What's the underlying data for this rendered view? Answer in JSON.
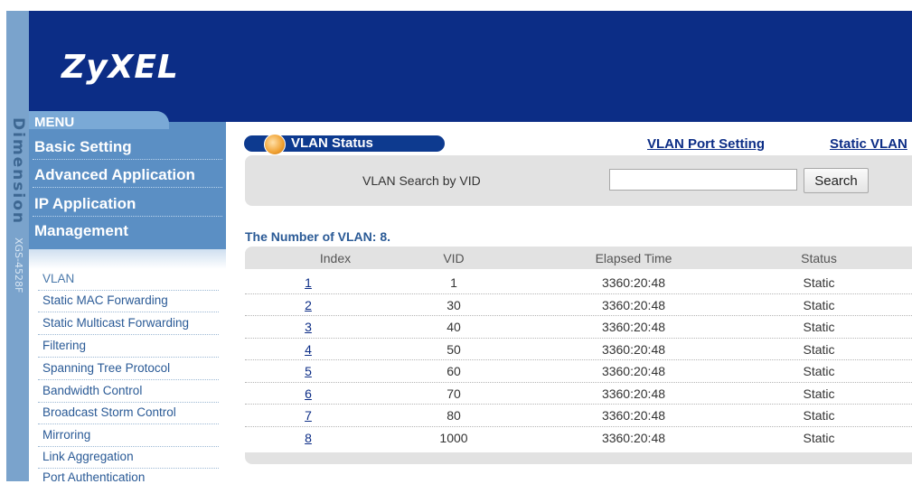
{
  "sidebar_brand": {
    "product": "Dimension",
    "model": "XGS-4528F"
  },
  "logo": "ZyXEL",
  "menu": {
    "title": "MENU",
    "sections": [
      {
        "label": "Basic Setting"
      },
      {
        "label": "Advanced Application"
      },
      {
        "label": "IP Application"
      },
      {
        "label": "Management"
      }
    ],
    "sub_items": [
      {
        "label": "VLAN"
      },
      {
        "label": "Static MAC Forwarding"
      },
      {
        "label": "Static Multicast Forwarding"
      },
      {
        "label": "Filtering"
      },
      {
        "label": "Spanning Tree Protocol"
      },
      {
        "label": "Bandwidth Control"
      },
      {
        "label": "Broadcast Storm Control"
      },
      {
        "label": "Mirroring"
      },
      {
        "label": "Link Aggregation"
      },
      {
        "label": "Port Authentication"
      }
    ]
  },
  "page": {
    "title": "VLAN Status",
    "links": {
      "port_setting": "VLAN Port Setting",
      "static_vlan": "Static VLAN"
    },
    "search": {
      "label": "VLAN Search by VID",
      "value": "",
      "button": "Search"
    },
    "count_text": "The Number of VLAN: 8."
  },
  "table": {
    "headers": {
      "index": "Index",
      "vid": "VID",
      "elapsed": "Elapsed Time",
      "status": "Status"
    },
    "rows": [
      {
        "index": "1",
        "vid": "1",
        "elapsed": "3360:20:48",
        "status": "Static"
      },
      {
        "index": "2",
        "vid": "30",
        "elapsed": "3360:20:48",
        "status": "Static"
      },
      {
        "index": "3",
        "vid": "40",
        "elapsed": "3360:20:48",
        "status": "Static"
      },
      {
        "index": "4",
        "vid": "50",
        "elapsed": "3360:20:48",
        "status": "Static"
      },
      {
        "index": "5",
        "vid": "60",
        "elapsed": "3360:20:48",
        "status": "Static"
      },
      {
        "index": "6",
        "vid": "70",
        "elapsed": "3360:20:48",
        "status": "Static"
      },
      {
        "index": "7",
        "vid": "80",
        "elapsed": "3360:20:48",
        "status": "Static"
      },
      {
        "index": "8",
        "vid": "1000",
        "elapsed": "3360:20:48",
        "status": "Static"
      }
    ]
  },
  "colors": {
    "banner": "#0c2d86",
    "menu": "#5b8fc4",
    "link": "#0c2d86",
    "panel": "#e2e2e2"
  }
}
